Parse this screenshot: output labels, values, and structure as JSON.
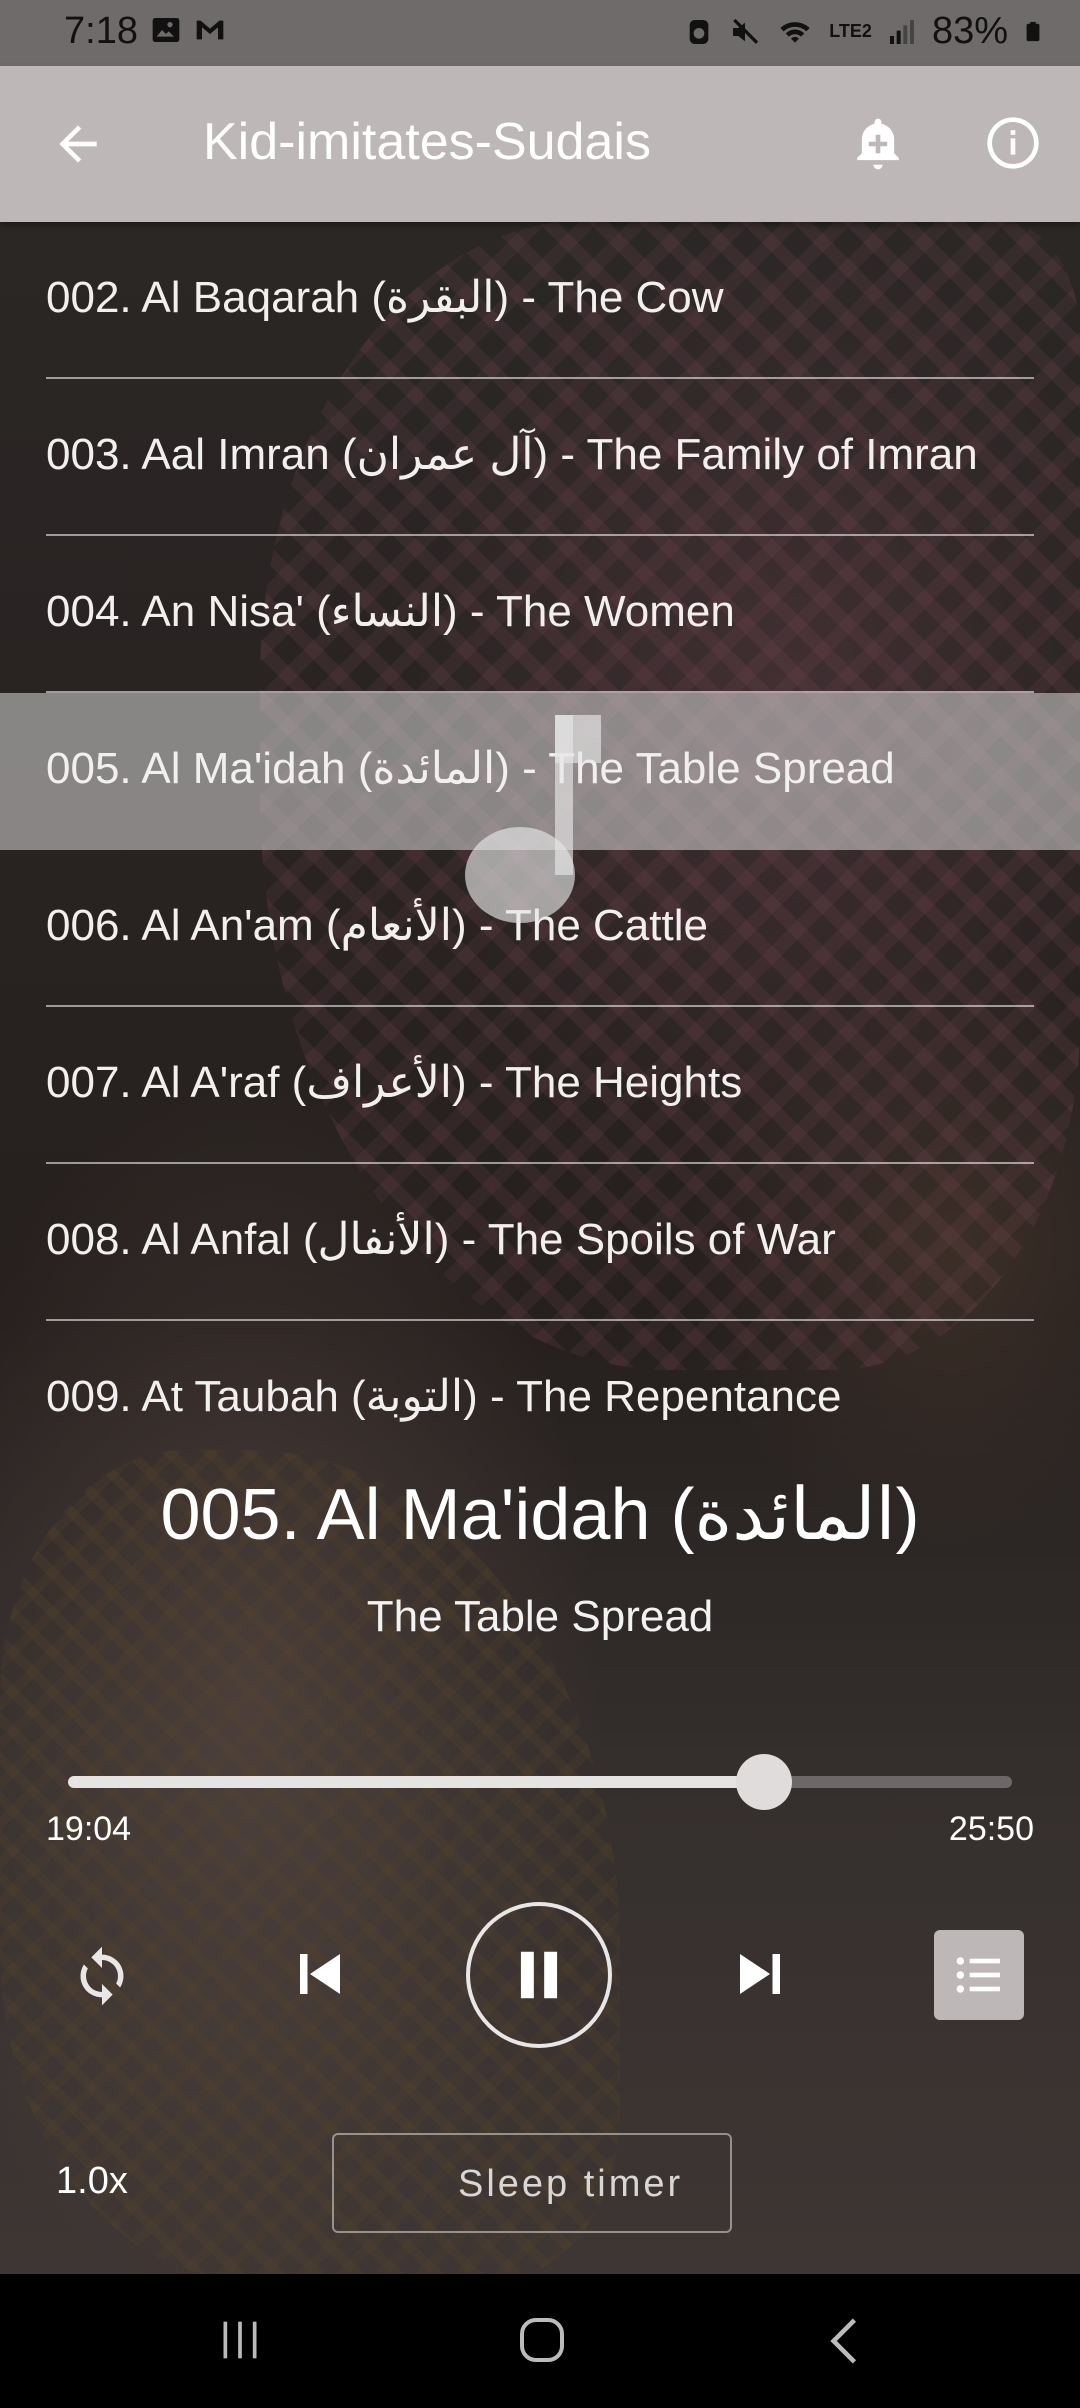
{
  "status_bar": {
    "time": "7:18",
    "battery": "83%",
    "network": "LTE2"
  },
  "app_bar": {
    "title": "Kid-imitates-Sudais"
  },
  "playlist": {
    "items": [
      {
        "label": "002. Al Baqarah (البقرة) - The Cow"
      },
      {
        "label": "003. Aal Imran (آل عمران) - The Family of Imran"
      },
      {
        "label": "004. An Nisa' (النساء) - The Women"
      },
      {
        "label": "005. Al Ma'idah (المائدة) - The Table Spread"
      },
      {
        "label": "006. Al An'am (الأنعام) - The Cattle"
      },
      {
        "label": "007. Al A'raf (الأعراف) - The Heights"
      },
      {
        "label": "008. Al Anfal (الأنفال) - The Spoils of War"
      },
      {
        "label": "009. At Taubah (التوبة) - The Repentance"
      }
    ],
    "active_index": 3
  },
  "now_playing": {
    "title": "005. Al Ma'idah (المائدة)",
    "subtitle": "The Table Spread",
    "elapsed": "19:04",
    "duration": "25:50",
    "progress": 0.737
  },
  "controls": {
    "speed": "1.0x",
    "sleep_timer_label": "Sleep timer"
  },
  "icons": {
    "back": "arrow-left-icon",
    "alarm": "alarm-add-icon",
    "info": "info-icon",
    "repeat": "repeat-icon",
    "previous": "skip-previous-icon",
    "pause": "pause-icon",
    "next": "skip-next-icon",
    "playlist": "playlist-icon",
    "sleep": "moon-icon"
  },
  "colors": {
    "app_bar": "#bdb7b7",
    "status_bar": "#6f6b6a",
    "active_row": "#d7d7d7"
  }
}
